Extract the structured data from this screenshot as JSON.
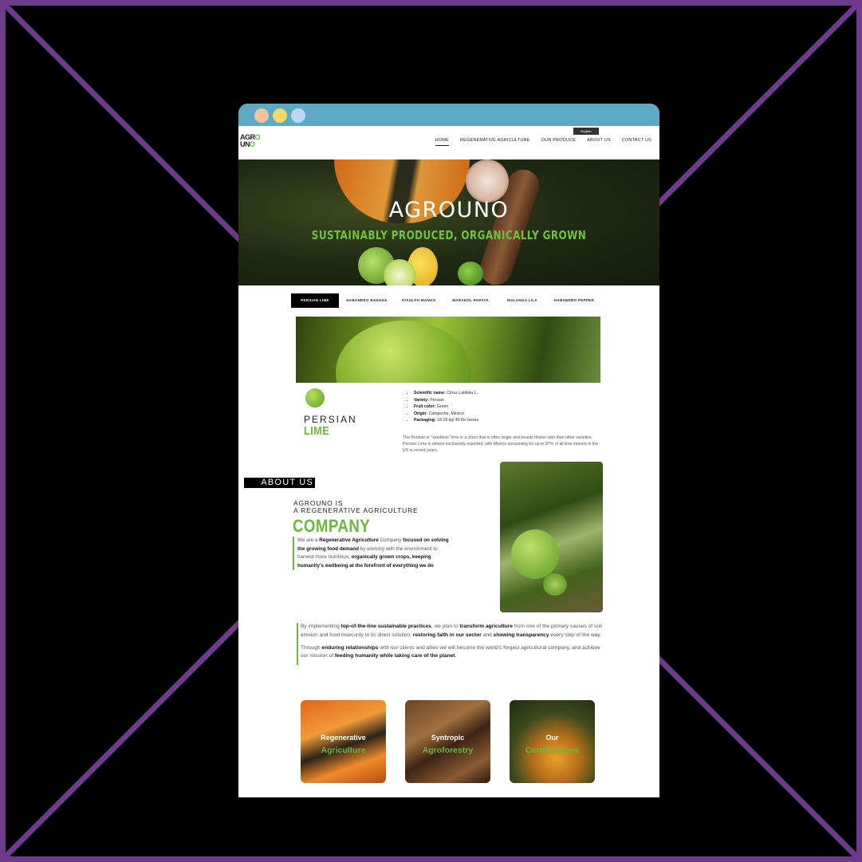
{
  "window": {
    "title": "AGROUNO"
  },
  "logo": {
    "line1a": "AGR",
    "line1b": "O",
    "line2a": "UN",
    "line2b": "O"
  },
  "language_selector": "English",
  "nav": {
    "items": [
      "HOME",
      "REGENERATIVE AGRICULTURE",
      "OUR PRODUCE",
      "ABOUT US",
      "CONTACT US"
    ],
    "active": "HOME"
  },
  "hero": {
    "title": "AGROUNO",
    "subtitle": "SUSTAINABLY PRODUCED, ORGANICALLY GROWN"
  },
  "product_tabs": [
    "PERSIAN LIME",
    "HABANERO BANANA",
    "ATAULFO MANGO",
    "MARADOL PAPAYA",
    "MALANGA LILA",
    "HABANERO PEPPER"
  ],
  "product": {
    "name_line1": "PERSIAN",
    "name_line2": "LIME",
    "specs": [
      {
        "label": "Scientific name:",
        "value": "Citrus Latifolia L."
      },
      {
        "label": "Variety:",
        "value": "Persian"
      },
      {
        "label": "Fruit color:",
        "value": "Green"
      },
      {
        "label": "Origin:",
        "value": "Campeche, México"
      },
      {
        "label": "Packaging:",
        "value": "18.18 kg/ 40 lbs boxes"
      }
    ],
    "description": "The Persian or \"seedless\" lime is a citrus that is often larger and boasts thicker skin than other varieties. Persian Lime is almost exclusively exported, with Mexico accounting for up to 97% of all lime imports in the US in recent years."
  },
  "about": {
    "label": "ABOUT US",
    "heading_line1": "AGROUNO IS",
    "heading_line2": "A REGENERATIVE AGRICULTURE",
    "heading_big": "COMPANY",
    "p1": "We are a ",
    "p2": "Regenerative Agriculture",
    "p3": " Company ",
    "p4": "focused on solving the growing food demand",
    "p5": " by working with the environment to harvest more nutritious, ",
    "p6": "organically grown crops, keeping humanity's wellbeing at the forefront of everything we do"
  },
  "mission": {
    "a1": "By implementing ",
    "a2": "top-of-the-line sustainable practices",
    "a3": ", we plan to ",
    "a4": "transform agriculture",
    "a5": " from one of the primary causes of soil erosion and food insecurity to its direct solution: ",
    "a6": "restoring faith in our sector",
    "a7": " and ",
    "a8": "showing transparency",
    "a9": " every step of the way.",
    "b1": "Through ",
    "b2": "enduring relationships",
    "b3": " with our clients and allies we will become the world's forgest agricultural company, and achieve our mission of ",
    "b4": "feeding humanity while taking care of the planet",
    "b5": "."
  },
  "cards": [
    {
      "line1": "Regenerative",
      "line2": "Agriculture"
    },
    {
      "line1": "Syntropic",
      "line2": "Agroforestry"
    },
    {
      "line1": "Our",
      "line2": "Certifications"
    }
  ],
  "colors": {
    "frame": "#6d3a8c",
    "titlebar": "#5ea9c3",
    "accent_green": "#6cb83a"
  }
}
